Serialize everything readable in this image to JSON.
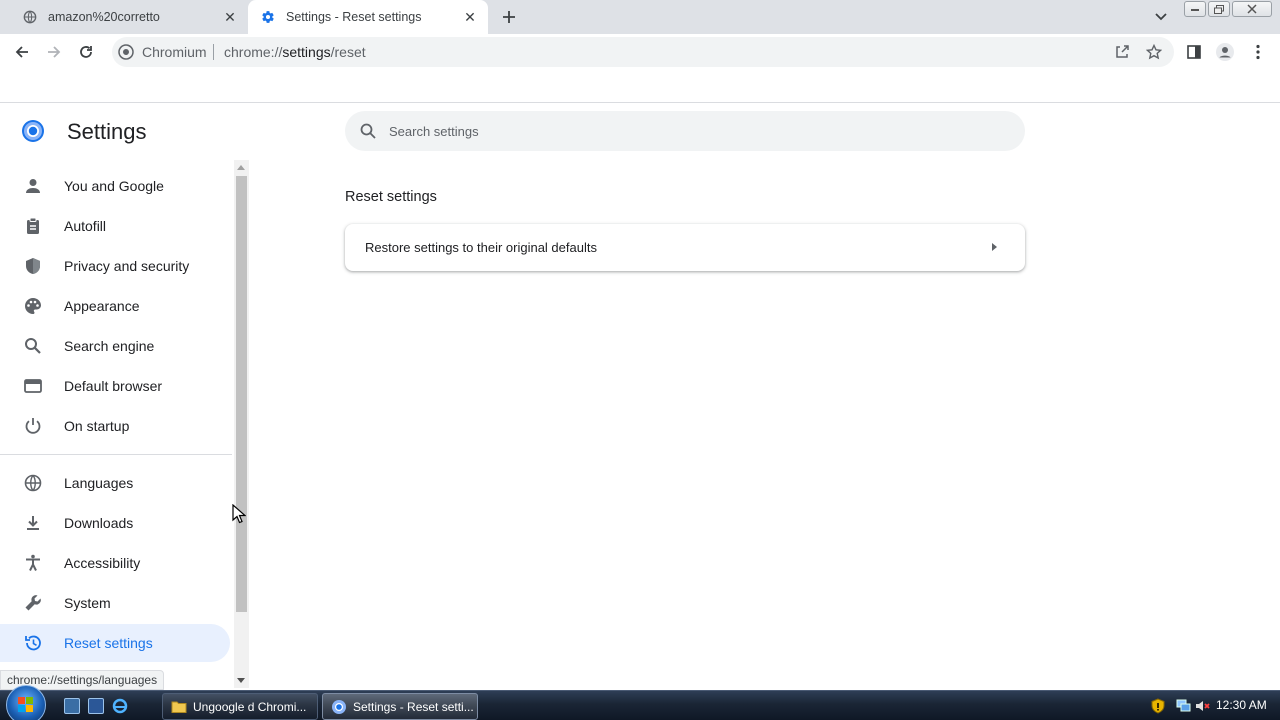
{
  "browser": {
    "tabs": [
      {
        "title": "amazon%20corretto",
        "favicon": "globe-icon",
        "active": false
      },
      {
        "title": "Settings - Reset settings",
        "favicon": "gear-icon",
        "active": true
      }
    ],
    "omnibox": {
      "site_chip": "Chromium",
      "url_scheme": "chrome://",
      "url_host": "settings",
      "url_path": "/reset"
    }
  },
  "settings": {
    "title": "Settings",
    "search_placeholder": "Search settings",
    "nav": [
      {
        "label": "You and Google",
        "icon": "person-icon"
      },
      {
        "label": "Autofill",
        "icon": "clipboard-icon"
      },
      {
        "label": "Privacy and security",
        "icon": "shield-icon"
      },
      {
        "label": "Appearance",
        "icon": "palette-icon"
      },
      {
        "label": "Search engine",
        "icon": "search-icon"
      },
      {
        "label": "Default browser",
        "icon": "browser-window-icon"
      },
      {
        "label": "On startup",
        "icon": "power-icon"
      },
      {
        "label": "Languages",
        "icon": "globe-icon"
      },
      {
        "label": "Downloads",
        "icon": "download-icon"
      },
      {
        "label": "Accessibility",
        "icon": "accessibility-icon"
      },
      {
        "label": "System",
        "icon": "wrench-icon"
      },
      {
        "label": "Reset settings",
        "icon": "history-icon",
        "active": true
      }
    ],
    "section_title": "Reset settings",
    "card_label": "Restore settings to their original defaults"
  },
  "status_url": "chrome://settings/languages",
  "taskbar": {
    "items": [
      {
        "label": "Ungoogle d Chromi...",
        "icon": "folder-icon"
      },
      {
        "label": "Settings - Reset setti...",
        "icon": "chromium-icon",
        "active": true
      }
    ],
    "clock": "12:30 AM"
  },
  "colors": {
    "accent": "#1a73e8",
    "active_nav_bg": "#e8f0fe",
    "tabstrip_bg": "#dee1e6"
  }
}
